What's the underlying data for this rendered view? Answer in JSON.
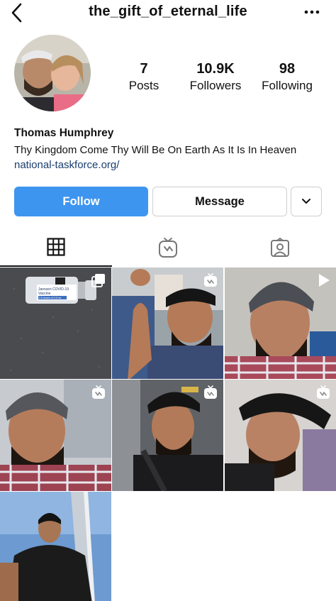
{
  "profile": {
    "username": "the_gift_of_eternal_life",
    "full_name": "Thomas Humphrey",
    "bio": "Thy Kingdom Come Thy Will Be On Earth As It Is In Heaven",
    "link": "national-taskforce.org/"
  },
  "stats": {
    "posts": "7",
    "posts_label": "Posts",
    "followers": "10.9K",
    "followers_label": "Followers",
    "following": "98",
    "following_label": "Following"
  },
  "actions": {
    "follow": "Follow",
    "message": "Message"
  },
  "tabs": [
    {
      "icon": "grid-icon",
      "active": true
    },
    {
      "icon": "igtv-icon",
      "active": false
    },
    {
      "icon": "tagged-icon",
      "active": false
    }
  ],
  "posts": [
    {
      "badge": "multi-photo-icon",
      "subject": "vaccine vial on gray carpet",
      "label_lines": [
        "Janssen COVID-19",
        "Vaccine",
        "2.5 doses of 0.5 mL"
      ]
    },
    {
      "badge": "igtv-icon",
      "subject": "bearded man in cap, arm raised"
    },
    {
      "badge": "play-icon",
      "subject": "bearded man in knit beanie selfie"
    },
    {
      "badge": "igtv-icon",
      "subject": "bearded man in beanie, plaid shirt"
    },
    {
      "badge": "igtv-icon",
      "subject": "bearded man in car with cap"
    },
    {
      "badge": "igtv-icon",
      "subject": "bearded man in black cap, tilted"
    },
    {
      "badge": "",
      "subject": "man under tall arch, blue sky"
    }
  ],
  "colors": {
    "follow_blue": "#3d95ef",
    "link_blue": "#1b3e6e"
  }
}
